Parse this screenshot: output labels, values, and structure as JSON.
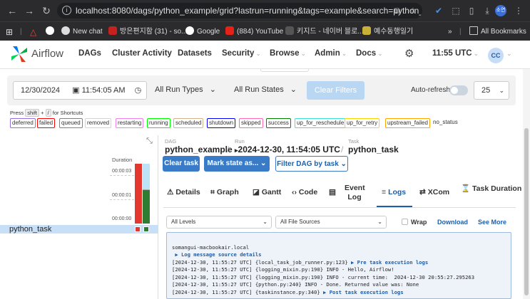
{
  "browser": {
    "url": "localhost:8080/dags/python_example/grid?lastrun=running&tags=example&search=python_...",
    "bookmarks": [
      "New chat",
      "방은편지함 (31) - so...",
      "Google",
      "(884) YouTube",
      "키지드 - 네이버 블로...",
      "예수동행일기"
    ],
    "all_bookmarks": "All Bookmarks",
    "profile": "소연"
  },
  "nav": {
    "logo": "Airflow",
    "items": [
      "DAGs",
      "Cluster Activity",
      "Datasets",
      "Security",
      "Browse",
      "Admin",
      "Docs"
    ],
    "time": "11:55 UTC",
    "user": "CC"
  },
  "filters": {
    "date": "12/30/2024",
    "time": "11:54:05 AM",
    "run_types": "All Run Types",
    "run_states": "All Run States",
    "clear": "Clear Filters",
    "autorefresh": "Auto-refresh",
    "count": "25"
  },
  "shortcuts": {
    "press": "Press",
    "key1": "shift",
    "plus": "+",
    "key2": "/",
    "for": "for Shortcuts"
  },
  "states": [
    {
      "label": "deferred",
      "color": "#9370db"
    },
    {
      "label": "failed",
      "color": "#ff0000"
    },
    {
      "label": "queued",
      "color": "#808080"
    },
    {
      "label": "removed",
      "color": "#d3d3d3"
    },
    {
      "label": "restarting",
      "color": "#ee82ee"
    },
    {
      "label": "running",
      "color": "#00ff00"
    },
    {
      "label": "scheduled",
      "color": "#d2b48c"
    },
    {
      "label": "shutdown",
      "color": "#0000ff"
    },
    {
      "label": "skipped",
      "color": "#ff69b4"
    },
    {
      "label": "success",
      "color": "#008000"
    },
    {
      "label": "up_for_reschedule",
      "color": "#40e0d0"
    },
    {
      "label": "up_for_retry",
      "color": "#ffd700"
    },
    {
      "label": "upstream_failed",
      "color": "#ffa500"
    },
    {
      "label": "no_status",
      "color": "#ffffff"
    }
  ],
  "grid": {
    "duration_label": "Duration",
    "ticks": [
      "00:00:03",
      "00:00:01",
      "00:00:00"
    ],
    "task": "python_task"
  },
  "details": {
    "dag_label": "DAG",
    "dag": "python_example",
    "run_label": "Run",
    "run": "2024-12-30, 11:54:05 UTC",
    "task_label": "Task",
    "task": "python_task",
    "clear_task": "Clear task",
    "mark_state": "Mark state as...",
    "filter_dag": "Filter DAG by task",
    "tabs": [
      "Details",
      "Graph",
      "Gantt",
      "Code",
      "Event Log",
      "Logs",
      "XCom",
      "Task Duration"
    ],
    "levels": "All Levels",
    "sources": "All File Sources",
    "wrap": "Wrap",
    "download": "Download",
    "see_more": "See More"
  },
  "log": {
    "host": "somangui-macbookair.local",
    "lines": [
      {
        "text": " ▶ Log message source details",
        "link": true
      },
      {
        "text": "[2024-12-30, 11:55:27 UTC] {local_task_job_runner.py:123} ",
        "tail": "▶ Pre task execution logs"
      },
      {
        "text": "[2024-12-30, 11:55:27 UTC] {logging_mixin.py:190} INFO - Hello, Airflow!"
      },
      {
        "text": "[2024-12-30, 11:55:27 UTC] {logging_mixin.py:190} INFO - current time:  2024-12-30 20:55:27.295263"
      },
      {
        "text": "[2024-12-30, 11:55:27 UTC] {python.py:240} INFO - Done. Returned value was: None"
      },
      {
        "text": "[2024-12-30, 11:55:27 UTC] {taskinstance.py:340} ",
        "tail": "▶ Post task execution logs"
      }
    ]
  }
}
